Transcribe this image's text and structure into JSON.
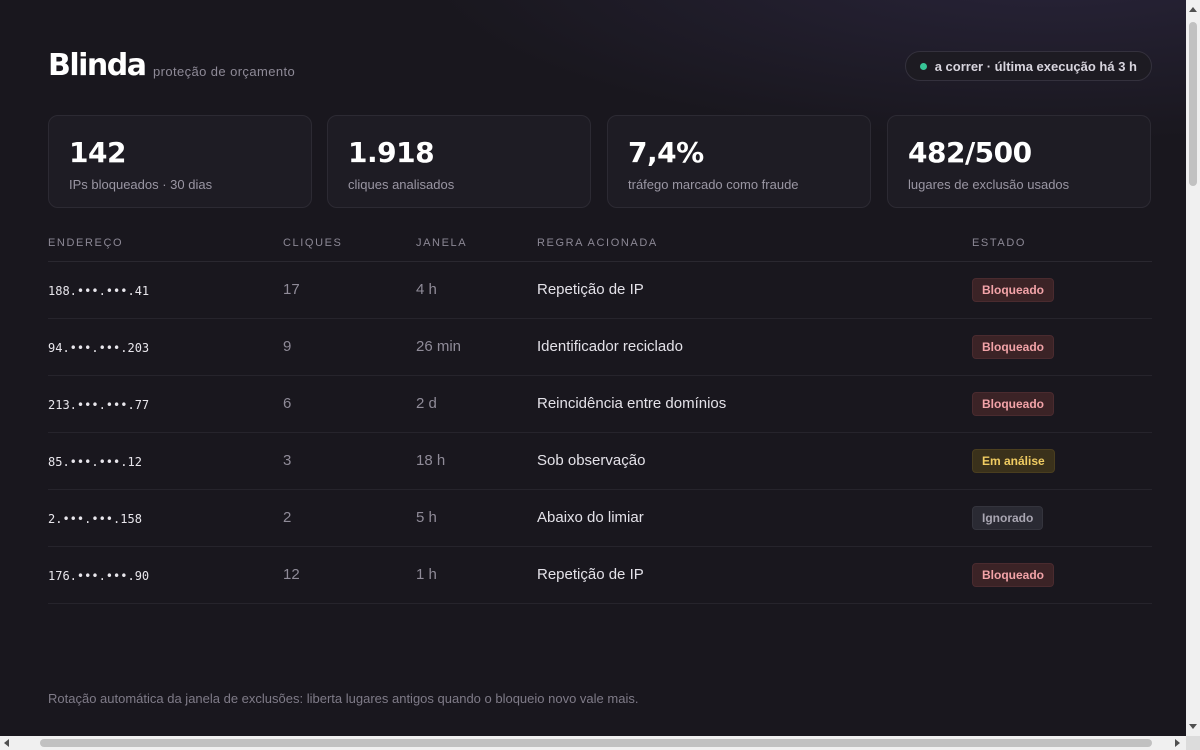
{
  "header": {
    "brand": "Blinda",
    "tagline": "proteção de orçamento",
    "status": "a correr · última execução há 3 h"
  },
  "stats": [
    {
      "value": "142",
      "label": "IPs bloqueados · 30 dias"
    },
    {
      "value": "1.918",
      "label": "cliques analisados"
    },
    {
      "value": "7,4%",
      "label": "tráfego marcado como fraude"
    },
    {
      "value": "482/500",
      "label": "lugares de exclusão usados"
    }
  ],
  "table": {
    "headers": {
      "address": "ENDEREÇO",
      "clicks": "CLIQUES",
      "window": "JANELA",
      "rule": "REGRA ACIONADA",
      "state": "ESTADO"
    },
    "rows": [
      {
        "address": "188.•••.•••.41",
        "clicks": "17",
        "window": "4 h",
        "rule": "Repetição de IP",
        "state": "Bloqueado"
      },
      {
        "address": "94.•••.•••.203",
        "clicks": "9",
        "window": "26 min",
        "rule": "Identificador reciclado",
        "state": "Bloqueado"
      },
      {
        "address": "213.•••.•••.77",
        "clicks": "6",
        "window": "2 d",
        "rule": "Reincidência entre domínios",
        "state": "Bloqueado"
      },
      {
        "address": "85.•••.•••.12",
        "clicks": "3",
        "window": "18 h",
        "rule": "Sob observação",
        "state": "Em análise"
      },
      {
        "address": "2.•••.•••.158",
        "clicks": "2",
        "window": "5 h",
        "rule": "Abaixo do limiar",
        "state": "Ignorado"
      },
      {
        "address": "176.•••.•••.90",
        "clicks": "12",
        "window": "1 h",
        "rule": "Repetição de IP",
        "state": "Bloqueado"
      }
    ]
  },
  "footnote": "Rotação automática da janela de exclusões: liberta lugares antigos quando o bloqueio novo vale mais.",
  "colors": {
    "status_running": "#37c597",
    "blocked": "#f2a3a8",
    "review": "#f0cc62",
    "ignored": "#a9a6b2"
  }
}
